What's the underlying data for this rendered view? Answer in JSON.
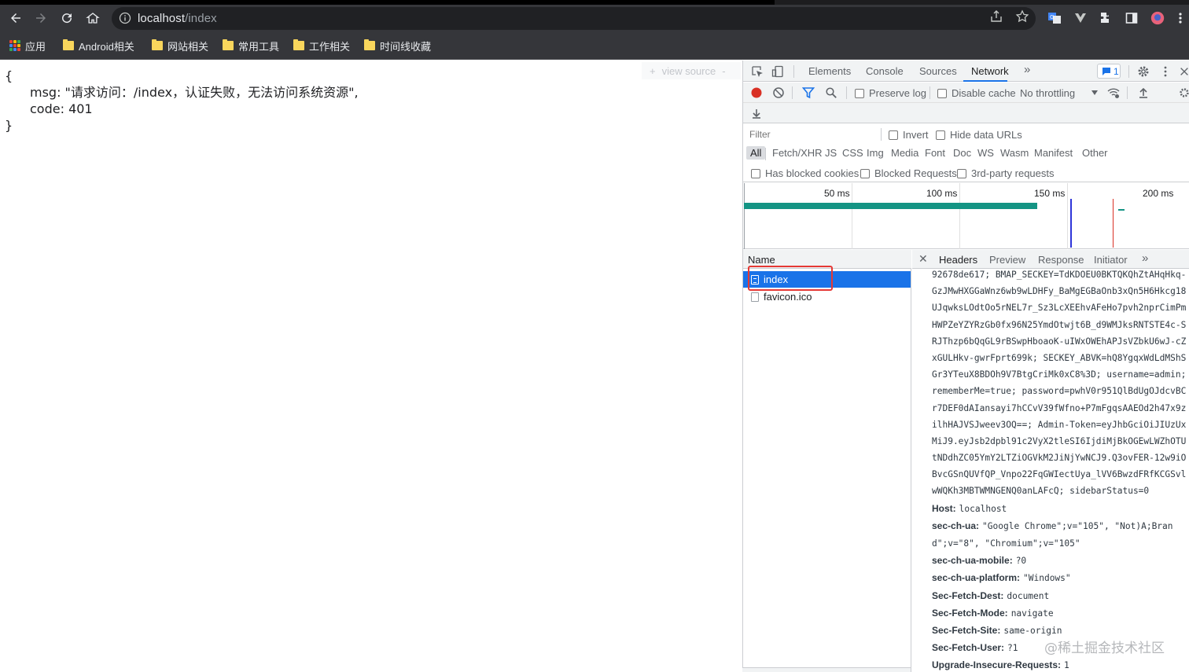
{
  "browser": {
    "url_host": "localhost",
    "url_path": "/index",
    "bookmarks": [
      {
        "label": "应用",
        "icon": "apps-grid-icon"
      },
      {
        "label": "Android相关",
        "icon": "folder-icon"
      },
      {
        "label": "网站相关",
        "icon": "folder-icon"
      },
      {
        "label": "常用工具",
        "icon": "folder-icon"
      },
      {
        "label": "工作相关",
        "icon": "folder-icon"
      },
      {
        "label": "时间线收藏",
        "icon": "folder-icon"
      }
    ]
  },
  "page": {
    "open_brace": "{",
    "msg_line": "msg: \"请求访问：/index，认证失败，无法访问系统资源\",",
    "code_line": "code: 401",
    "close_brace": "}",
    "view_source": "view source"
  },
  "devtools": {
    "tabs": [
      "Elements",
      "Console",
      "Sources",
      "Network"
    ],
    "active_tab": "Network",
    "issues_count": "1",
    "toolbar": {
      "preserve_log": "Preserve log",
      "disable_cache": "Disable cache",
      "throttling": "No throttling"
    },
    "filter": {
      "placeholder": "Filter",
      "invert": "Invert",
      "hide_data_urls": "Hide data URLs"
    },
    "types": [
      "All",
      "Fetch/XHR",
      "JS",
      "CSS",
      "Img",
      "Media",
      "Font",
      "Doc",
      "WS",
      "Wasm",
      "Manifest",
      "Other"
    ],
    "blocked": {
      "has_blocked_cookies": "Has blocked cookies",
      "blocked_requests": "Blocked Requests",
      "third_party": "3rd-party requests"
    },
    "timeline": {
      "ticks": [
        "50 ms",
        "100 ms",
        "150 ms",
        "200 ms"
      ]
    },
    "requests": {
      "header": "Name",
      "items": [
        "index",
        "favicon.ico"
      ],
      "selected": "index"
    },
    "detail_tabs": [
      "Headers",
      "Preview",
      "Response",
      "Initiator"
    ],
    "cookie_lines": [
      "92678de617; BMAP_SECKEY=TdKDOEU0BKTQKQhZtAHqHkq-",
      "GzJMwHXGGaWnz6wb9wLDHFy_BaMgEGBaOnb3xQn5H6Hkcg18",
      "UJqwksLOdtOo5rNEL7r_Sz3LcXEEhvAFeHo7pvh2nprCimPm",
      "HWPZeYZYRzGb0fx96N25YmdOtwjt6B_d9WMJksRNTSTE4c-S",
      "RJThzp6bQqGL9rBSwpHboaoK-uIWxOWEhAPJsVZbkU6wJ-cZ",
      "xGULHkv-gwrFprt699k; SECKEY_ABVK=hQ8YgqxWdLdMShS",
      "Gr3YTeuX8BDOh9V7BtgCriMk0xC8%3D; username=admin;",
      "rememberMe=true; password=pwhV0r951QlBdUgOJdcvBC",
      "r7DEF0dAIansayi7hCCvV39fWfno+P7mFgqsAAEOd2h47x9z",
      "ilhHAJVSJweev3OQ==; Admin-Token=eyJhbGciOiJIUzUx",
      "MiJ9.eyJsb2dpbl91c2VyX2tleSI6IjdiMjBkOGEwLWZhOTU",
      "tNDdhZC05YmY2LTZiOGVkM2JiNjYwNCJ9.Q3ovFER-12w9iO",
      "BvcGSnQUVfQP_Vnpo22FqGWIectUya_lVV6BwzdFRfKCGSvl",
      "wWQKh3MBTWMNGENQ0anLAFcQ; sidebarStatus=0"
    ],
    "headers": [
      {
        "key": "Host:",
        "value": "localhost"
      },
      {
        "key": "sec-ch-ua:",
        "value": "\"Google Chrome\";v=\"105\", \"Not)A;Bran"
      },
      {
        "key": "",
        "value": "d\";v=\"8\", \"Chromium\";v=\"105\""
      },
      {
        "key": "sec-ch-ua-mobile:",
        "value": "?0"
      },
      {
        "key": "sec-ch-ua-platform:",
        "value": "\"Windows\""
      },
      {
        "key": "Sec-Fetch-Dest:",
        "value": "document"
      },
      {
        "key": "Sec-Fetch-Mode:",
        "value": "navigate"
      },
      {
        "key": "Sec-Fetch-Site:",
        "value": "same-origin"
      },
      {
        "key": "Sec-Fetch-User:",
        "value": "?1"
      },
      {
        "key": "Upgrade-Insecure-Requests:",
        "value": "1"
      }
    ]
  },
  "watermark": "@稀土掘金技术社区",
  "colors": {
    "accent": "#1a73e8",
    "record_red": "#d93025",
    "timeline_green": "#149484",
    "highlight_red": "#e53935"
  }
}
